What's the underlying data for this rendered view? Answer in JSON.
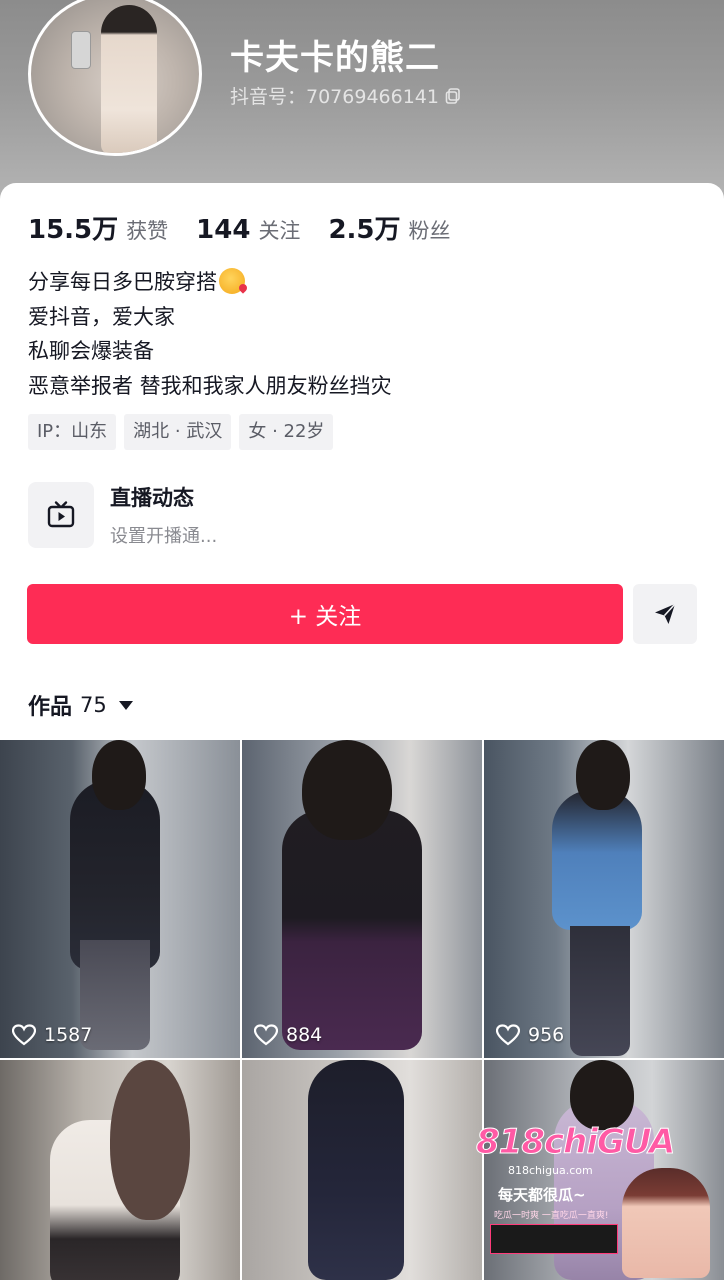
{
  "profile": {
    "nickname": "卡夫卡的熊二",
    "douyin_id": "抖音号：70769466141"
  },
  "stats": [
    {
      "value": "15.5万",
      "label": "获赞"
    },
    {
      "value": "144",
      "label": "关注"
    },
    {
      "value": "2.5万",
      "label": "粉丝"
    }
  ],
  "bio": {
    "line1": "分享每日多巴胺穿搭",
    "line2": "爱抖音，爱大家",
    "line3": "私聊会爆装备",
    "line4": "恶意举报者 替我和我家人朋友粉丝挡灾"
  },
  "tags": [
    "IP：山东",
    "湖北 · 武汉",
    "女 · 22岁"
  ],
  "live": {
    "title": "直播动态",
    "subtitle": "设置开播通..."
  },
  "actions": {
    "follow_label": "+ 关注"
  },
  "works": {
    "label": "作品",
    "count": "75"
  },
  "grid": [
    {
      "likes": "1587"
    },
    {
      "likes": "884"
    },
    {
      "likes": "956"
    },
    {
      "likes": ""
    },
    {
      "likes": ""
    },
    {
      "likes": ""
    }
  ],
  "ad": {
    "logo": "818chiGUA",
    "url": "818chigua.com",
    "slogan": "每天都很瓜~",
    "sub": "吃瓜一时爽 一直吃瓜一直爽!"
  },
  "colors": {
    "accent": "#fe2c55",
    "text": "#161823",
    "secondary": "#6b6d75",
    "chip_bg": "#f2f2f4"
  }
}
